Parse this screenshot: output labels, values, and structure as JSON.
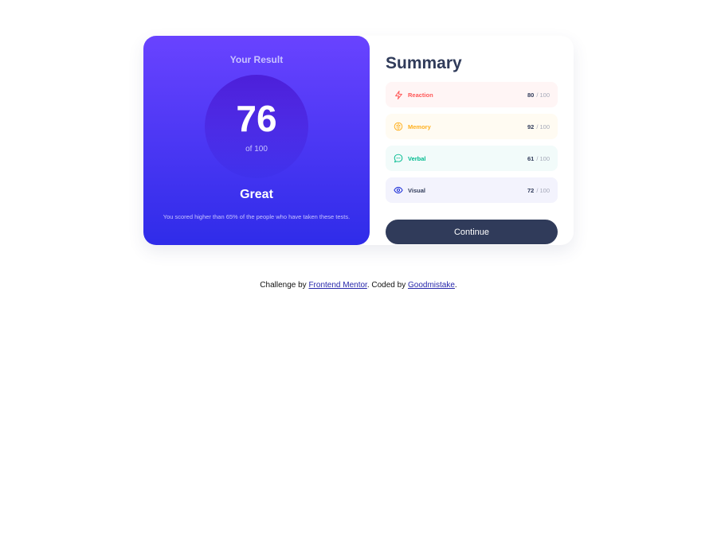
{
  "result": {
    "title": "Your Result",
    "score": "76",
    "max": "of 100",
    "grade": "Great",
    "description": "You scored higher than 65% of the people who have taken these tests."
  },
  "summary": {
    "title": "Summary",
    "items": [
      {
        "label": "Reaction",
        "value": "80",
        "max": "/ 100",
        "icon": "lightning-icon",
        "color": "#ff5757",
        "bg": "#fff5f5"
      },
      {
        "label": "Memory",
        "value": "92",
        "max": "/ 100",
        "icon": "brain-icon",
        "color": "#ffb01f",
        "bg": "#fffbf2"
      },
      {
        "label": "Verbal",
        "value": "61",
        "max": "/ 100",
        "icon": "chat-bubble-icon",
        "color": "#00bb8f",
        "bg": "#f2fbfa"
      },
      {
        "label": "Visual",
        "value": "72",
        "max": "/ 100",
        "icon": "eye-icon",
        "color": "#1125d6",
        "bg": "#f3f3fd"
      }
    ],
    "continue_label": "Continue"
  },
  "footer": {
    "prefix": "Challenge by ",
    "link1": "Frontend Mentor",
    "middle": ". Coded by ",
    "link2": "Goodmistake",
    "suffix": "."
  }
}
